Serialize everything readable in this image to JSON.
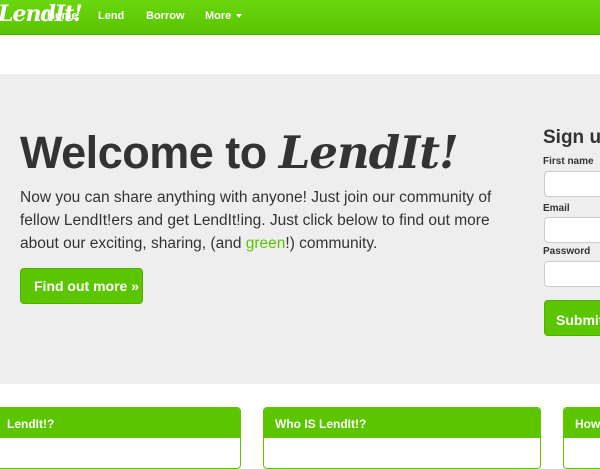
{
  "navbar": {
    "brand": "LendIt!",
    "links": [
      "Home",
      "Lend",
      "Borrow",
      "More"
    ]
  },
  "hero": {
    "title_plain": "Welcome to ",
    "title_brand": "LendIt!",
    "text_before": "Now you can share anything with anyone! Just join our community of fellow LendIt!ers and get LendIt!ing. Just click below to find out more about our exciting, sharing, (and ",
    "text_green": "green",
    "text_after": "!) community.",
    "button_label": "Find out more »"
  },
  "signup": {
    "title": "Sign up",
    "first_name_label": "First name",
    "email_label": "Email",
    "password_label": "Password",
    "submit_label": "Submit"
  },
  "features": [
    {
      "heading": "LendIt!?"
    },
    {
      "heading": "Who IS LendIt!?"
    },
    {
      "heading": "How"
    }
  ],
  "colors": {
    "brand_green": "#5bc600",
    "hero_background": "#eeeeee",
    "text": "#333333"
  }
}
